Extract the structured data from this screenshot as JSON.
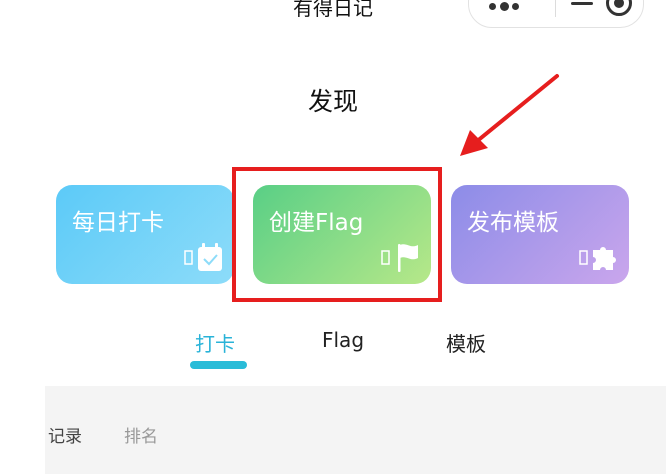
{
  "header": {
    "app_title": "有得日记"
  },
  "page": {
    "title": "发现"
  },
  "cards": [
    {
      "label": "每日打卡",
      "icon": "calendar-check-icon"
    },
    {
      "label": "创建Flag",
      "icon": "flag-icon"
    },
    {
      "label": "发布模板",
      "icon": "puzzle-icon"
    }
  ],
  "tabs": [
    {
      "label": "打卡",
      "active": true
    },
    {
      "label": "Flag",
      "active": false
    },
    {
      "label": "模板",
      "active": false
    }
  ],
  "subtabs": [
    {
      "label": "记录",
      "active": true
    },
    {
      "label": "排名",
      "active": false
    }
  ],
  "colors": {
    "accent": "#29b3d8",
    "highlight_box": "#e61e1e",
    "card_checkin": "#5ccaf8",
    "card_flag": "#59cf86",
    "card_template": "#8c8ce8"
  }
}
